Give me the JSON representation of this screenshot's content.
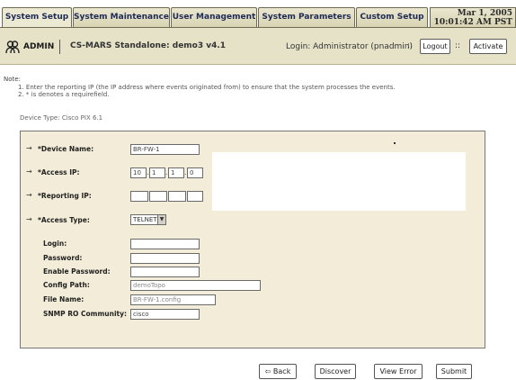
{
  "tabs": [
    {
      "label": "System Setup"
    },
    {
      "label": "System Maintenance"
    },
    {
      "label": "User Management"
    },
    {
      "label": "System Parameters"
    },
    {
      "label": "Custom Setup"
    }
  ],
  "datetime": {
    "date": "Mar 1, 2005",
    "time": "10:01:42 AM PST"
  },
  "header": {
    "user_role": "ADMIN",
    "system_title": "CS-MARS Standalone: demo3 v4.1",
    "login_info": "Login: Administrator (pnadmin)",
    "sep": "::",
    "logout_label": "Logout",
    "activate_label": "Activate"
  },
  "notes": {
    "heading": "Note:",
    "line1": "1. Enter the reporting IP (the IP address where events originated from) to ensure that the system processes the events.",
    "line2": "2. * is denotes a requirefield."
  },
  "device_type": "Device Type: Cisco PIX 6.1",
  "form": {
    "arrow": "→",
    "device_name": {
      "label": "*Device Name:",
      "value": "BR-FW-1"
    },
    "access_ip": {
      "label": "*Access IP:",
      "octets": [
        "10",
        "1",
        "1",
        "0"
      ]
    },
    "reporting_ip": {
      "label": "*Reporting IP:",
      "octets": [
        "",
        "",
        "",
        ""
      ]
    },
    "access_type": {
      "label": "*Access Type:",
      "value": "TELNET",
      "dropdown_glyph": "▼"
    },
    "login": {
      "label": "Login:",
      "value": ""
    },
    "password": {
      "label": "Password:",
      "value": ""
    },
    "enable_password": {
      "label": "Enable Password:",
      "value": ""
    },
    "config_path": {
      "label": "Config Path:",
      "value": "demoTopo"
    },
    "file_name": {
      "label": "File Name:",
      "value": "BR-FW-1.config"
    },
    "snmp_community": {
      "label": "SNMP RO Community:",
      "value": "cisco"
    },
    "dot": "."
  },
  "buttons": {
    "back": "⇦ Back",
    "discover": "Discover",
    "view_error": "View Error",
    "submit": "Submit"
  }
}
